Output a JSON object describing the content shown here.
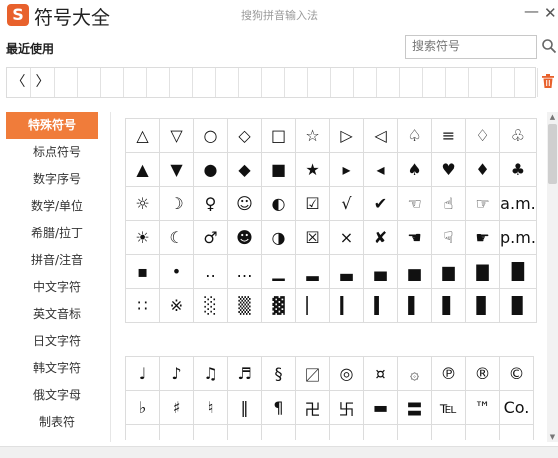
{
  "titlebar": {
    "logo_letter": "S",
    "app_title": "符号大全",
    "ime_title": "搜狗拼音输入法",
    "minimize_glyph": "—",
    "close_glyph": "✕"
  },
  "recent": {
    "label": "最近使用",
    "nav_prev": "〈",
    "nav_next": "〉"
  },
  "search": {
    "placeholder": "搜索符号"
  },
  "sidebar": {
    "items": [
      {
        "label": "特殊符号",
        "active": true
      },
      {
        "label": "标点符号",
        "active": false
      },
      {
        "label": "数字序号",
        "active": false
      },
      {
        "label": "数学/单位",
        "active": false
      },
      {
        "label": "希腊/拉丁",
        "active": false
      },
      {
        "label": "拼音/注音",
        "active": false
      },
      {
        "label": "中文字符",
        "active": false
      },
      {
        "label": "英文音标",
        "active": false
      },
      {
        "label": "日文字符",
        "active": false
      },
      {
        "label": "韩文字符",
        "active": false
      },
      {
        "label": "俄文字母",
        "active": false
      },
      {
        "label": "制表符",
        "active": false
      }
    ]
  },
  "grid1": [
    [
      "△",
      "▽",
      "○",
      "◇",
      "□",
      "☆",
      "▷",
      "◁",
      "♤",
      "≡",
      "♢",
      "♧"
    ],
    [
      "▲",
      "▼",
      "●",
      "◆",
      "■",
      "★",
      "▸",
      "◂",
      "♠",
      "♥",
      "♦",
      "♣"
    ],
    [
      "☼",
      "☽",
      "♀",
      "☺",
      "◐",
      "☑",
      "√",
      "✔",
      "☜",
      "☝",
      "☞",
      "a.m."
    ],
    [
      "☀",
      "☾",
      "♂",
      "☻",
      "◑",
      "☒",
      "×",
      "✘",
      "☚",
      "☟",
      "☛",
      "p.m."
    ],
    [
      "▪",
      "•",
      "‥",
      "…",
      "▁",
      "▂",
      "▃",
      "▄",
      "▅",
      "▆",
      "▇",
      "█"
    ],
    [
      "∷",
      "※",
      "░",
      "▒",
      "▓",
      "▏",
      "▎",
      "▍",
      "▌",
      "▋",
      "▊",
      "▉"
    ]
  ],
  "grid2": [
    [
      "♩",
      "♪",
      "♫",
      "♬",
      "§",
      "〼",
      "◎",
      "¤",
      "۞",
      "℗",
      "®",
      "©"
    ],
    [
      "♭",
      "♯",
      "♮",
      "‖",
      "¶",
      "卍",
      "卐",
      "▬",
      "〓",
      "℡",
      "™",
      "Co."
    ],
    [
      "",
      "",
      "",
      "",
      "",
      "",
      "",
      "",
      "",
      "",
      "",
      ""
    ]
  ],
  "scrollbar": {
    "up_glyph": "▲",
    "down_glyph": "▼"
  }
}
